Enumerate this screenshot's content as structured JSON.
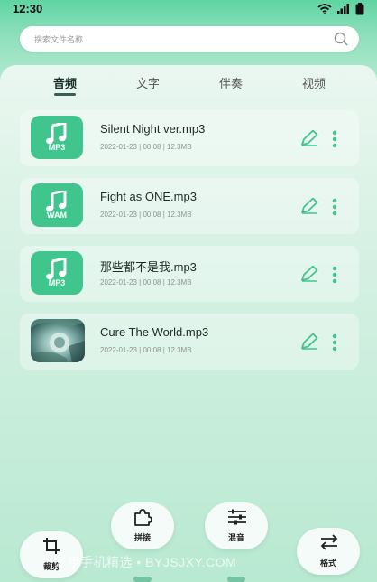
{
  "status_bar": {
    "time": "12:30"
  },
  "search": {
    "placeholder": "搜索文件名称"
  },
  "tabs": [
    {
      "label": "音频",
      "active": true
    },
    {
      "label": "文字",
      "active": false
    },
    {
      "label": "伴奏",
      "active": false
    },
    {
      "label": "视频",
      "active": false
    }
  ],
  "files": [
    {
      "name": "Silent Night ver.mp3",
      "meta": "2022-01-23 | 00:08 | 12.3MB",
      "format": "MP3",
      "icon": "music-note-icon"
    },
    {
      "name": "Fight as ONE.mp3",
      "meta": "2022-01-23 | 00:08 | 12.3MB",
      "format": "WAM",
      "icon": "music-note-icon"
    },
    {
      "name": "那些都不是我.mp3",
      "meta": "2022-01-23 | 00:08 | 12.3MB",
      "format": "MP3",
      "icon": "music-note-icon"
    },
    {
      "name": "Cure The World.mp3",
      "meta": "2022-01-23 | 00:08 | 12.3MB",
      "format": "",
      "icon": "album-cover"
    }
  ],
  "actions": {
    "crop": {
      "label": "裁剪",
      "icon": "crop-icon"
    },
    "join": {
      "label": "拼接",
      "icon": "puzzle-icon"
    },
    "mix": {
      "label": "混音",
      "icon": "equalizer-icon"
    },
    "format": {
      "label": "格式",
      "icon": "swap-arrows-icon"
    }
  },
  "watermark": "必用手机精选 • BYJSJXY.COM",
  "colors": {
    "accent": "#3fc58d",
    "tab_active": "#1a2e2a",
    "icon_green": "#3fc58d"
  }
}
